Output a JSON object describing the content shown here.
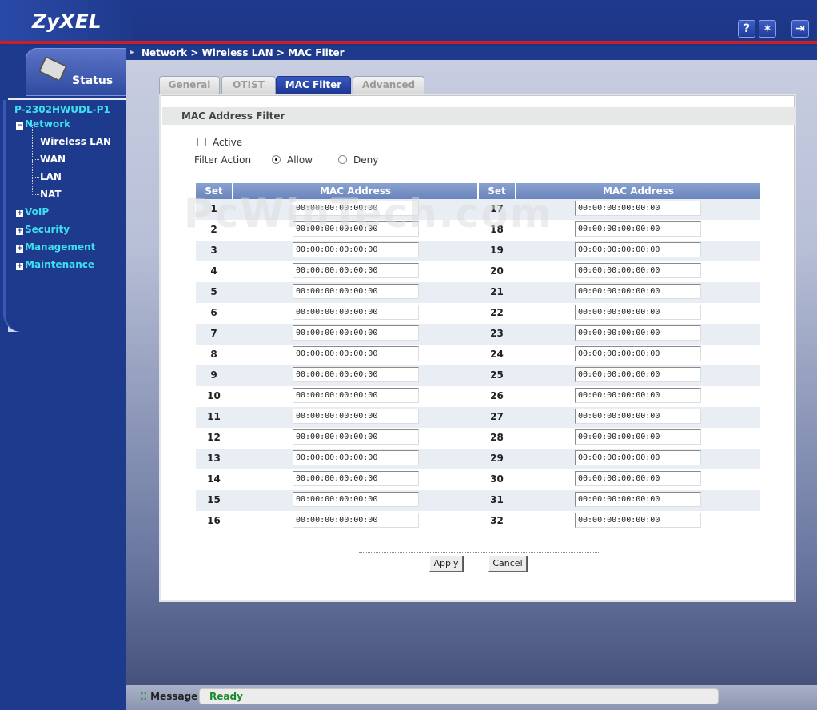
{
  "header": {
    "logo": "ZyXEL",
    "icons": [
      "help-icon",
      "wizard-icon",
      "logout-icon"
    ]
  },
  "sidebar": {
    "status_label": "Status",
    "device_name": "P-2302HWUDL-P1",
    "menu": [
      {
        "label": "Network",
        "expanded": true,
        "sub": [
          "Wireless LAN",
          "WAN",
          "LAN",
          "NAT"
        ]
      },
      {
        "label": "VoIP",
        "expanded": false
      },
      {
        "label": "Security",
        "expanded": false
      },
      {
        "label": "Management",
        "expanded": false
      },
      {
        "label": "Maintenance",
        "expanded": false
      }
    ]
  },
  "breadcrumb": "Network > Wireless LAN > MAC Filter",
  "tabs": [
    "General",
    "OTIST",
    "MAC Filter",
    "Advanced"
  ],
  "active_tab": "MAC Filter",
  "form": {
    "section_title": "MAC Address Filter",
    "active_label": "Active",
    "active_checked": false,
    "filter_action_label": "Filter Action",
    "allow_label": "Allow",
    "deny_label": "Deny",
    "filter_action_value": "Allow"
  },
  "table": {
    "set_header": "Set",
    "mac_header": "MAC Address",
    "left_sets": [
      "1",
      "2",
      "3",
      "4",
      "5",
      "6",
      "7",
      "8",
      "9",
      "10",
      "11",
      "12",
      "13",
      "14",
      "15",
      "16"
    ],
    "right_sets": [
      "17",
      "18",
      "19",
      "20",
      "21",
      "22",
      "23",
      "24",
      "25",
      "26",
      "27",
      "28",
      "29",
      "30",
      "31",
      "32"
    ],
    "mac_value": "00:00:00:00:00:00"
  },
  "buttons": {
    "apply": "Apply",
    "cancel": "Cancel"
  },
  "footer": {
    "message_label": "Message",
    "message_value": "Ready"
  },
  "watermark": "PcWinTech.com"
}
